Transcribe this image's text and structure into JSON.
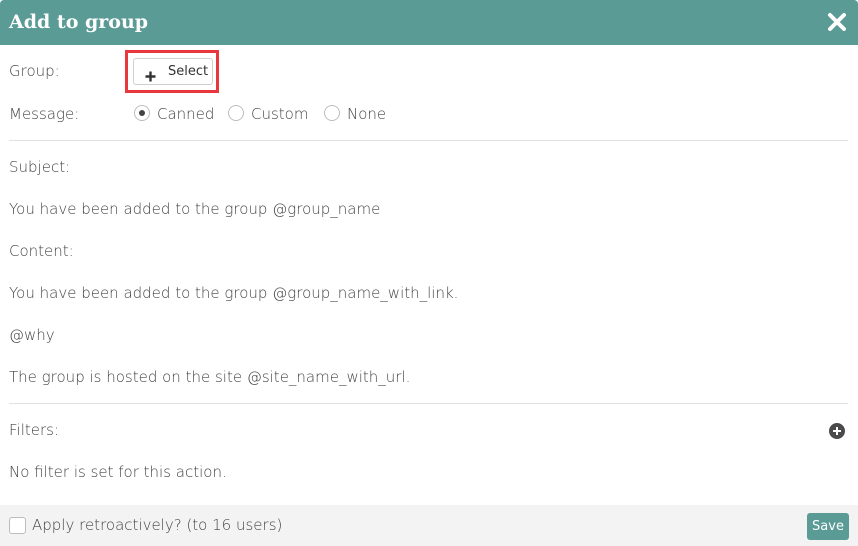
{
  "dialog": {
    "title": "Add to group",
    "close_icon": "close-x-icon"
  },
  "group": {
    "label": "Group:",
    "select_button": {
      "icon": "plus-icon",
      "label": "Select"
    },
    "highlight_color": "#e8383d"
  },
  "message": {
    "label": "Message:",
    "options": [
      {
        "label": "Canned",
        "selected": true
      },
      {
        "label": "Custom",
        "selected": false
      },
      {
        "label": "None",
        "selected": false
      }
    ]
  },
  "body": {
    "subject_label": "Subject:",
    "subject_value": "You have been added to the group @group_name",
    "content_label": "Content:",
    "content_lines": [
      "You have been added to the group @group_name_with_link.",
      "@why",
      "The group is hosted on the site @site_name_with_url."
    ]
  },
  "filters": {
    "label": "Filters:",
    "add_icon": "plus-circle-icon",
    "empty_text": "No filter is set for this action."
  },
  "footer": {
    "retroactive_label": "Apply retroactively? (to 16 users)",
    "retroactive_checked": false,
    "save_label": "Save"
  },
  "colors": {
    "accent": "#5a9b95",
    "text": "#444444",
    "divider": "#e2e2e2",
    "footer_bg": "#f3f3f3"
  }
}
